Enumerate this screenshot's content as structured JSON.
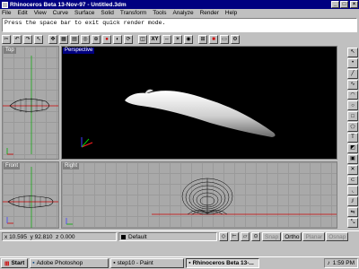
{
  "window": {
    "title": "Rhinoceros Beta 13-Nov-97 - Untitled.3dm",
    "min": "_",
    "max": "□",
    "close": "×"
  },
  "menu": [
    "File",
    "Edit",
    "View",
    "Curve",
    "Surface",
    "Solid",
    "Transform",
    "Tools",
    "Analyze",
    "Render",
    "Help"
  ],
  "command": {
    "prompt": "Press the space bar to exit quick render mode."
  },
  "toolbar": {
    "xy_label": "XY",
    "items": [
      "cut-icon",
      "undo-icon",
      "redo-icon",
      "arrow-icon",
      "pan-icon",
      "grid-icon",
      "layer-icon",
      "snap-icon",
      "zoom-icon",
      "render-icon",
      "shade-icon",
      "rotate-icon",
      "view-icon",
      "xy",
      "move-icon",
      "light-icon",
      "camera-icon",
      "mesh-icon",
      "color-icon",
      "window-icon",
      "settings-icon"
    ]
  },
  "viewports": {
    "top": "Top",
    "perspective": "Perspective",
    "front": "Front",
    "right": "Right"
  },
  "status": {
    "x_label": "x",
    "x": "10.595",
    "y_label": "y",
    "y": "92.810",
    "z_label": "z",
    "z": "0.000",
    "layer": "Default",
    "snap": "Snap",
    "ortho": "Ortho",
    "planar": "Planar",
    "osnap": "Osnap"
  },
  "taskbar": {
    "start": "Start",
    "tasks": [
      "Adobe Photoshop",
      "step10 - Paint",
      "Rhinoceros Beta 13-..."
    ],
    "clock": "1:59 PM"
  },
  "colors": {
    "titlebar": "#000080",
    "viewport_bg": "#a9a9a9",
    "perspective_bg": "#000000",
    "axis_x": "#ff0000",
    "axis_y": "#00aa00",
    "axis_z": "#0000ff"
  }
}
